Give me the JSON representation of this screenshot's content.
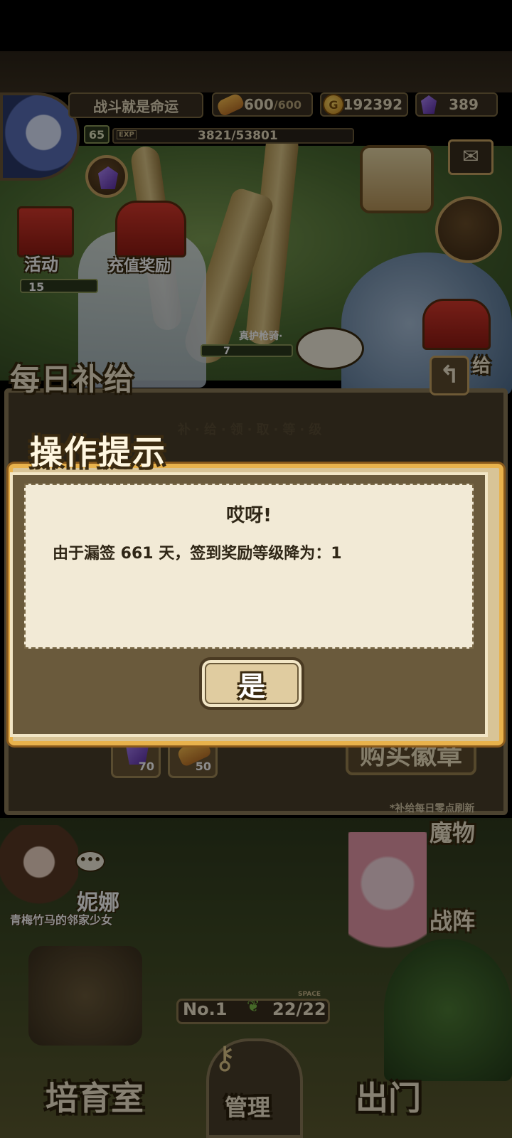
{
  "hud": {
    "player_title": "战斗就是命运",
    "bread_current": "600",
    "bread_max": "/600",
    "gold": "192392",
    "gems": "389",
    "level": "65",
    "exp_tag": "EXP",
    "exp_text": "3821/53801"
  },
  "scene": {
    "event_label": "活动",
    "recharge_label": "充值奖励",
    "small_level_1": "15",
    "small_level_2": "7",
    "knight_label": "真护枪骑·",
    "supply_side_label": "给"
  },
  "daily": {
    "title": "每日补给",
    "subtitle": "补·给·领·取·等·级",
    "item1_count": "70",
    "item2_count": "50",
    "buy_label": "购买徽章",
    "refresh_note": "*补给每日零点刷新"
  },
  "dialog": {
    "title": "操作提示",
    "heading": "哎呀!",
    "message": "由于漏签 661 天，签到奖励等级降为：1",
    "confirm_label": "是"
  },
  "bottom": {
    "npc_name": "妮娜",
    "npc_desc": "青梅竹马的邻家少女",
    "monster_label": "魔物",
    "formation_label": "战阵",
    "rank_label": "No.1",
    "space_tag": "SPACE",
    "space_value": "22/22",
    "nav_nursery": "培育室",
    "nav_manage": "管理",
    "nav_exit": "出门"
  }
}
